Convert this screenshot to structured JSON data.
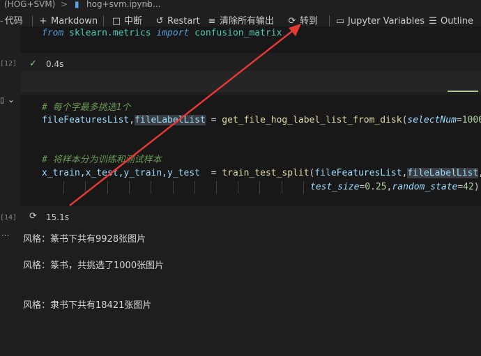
{
  "breadcrumb": {
    "kernel": "(HOG+SVM)",
    "separator": ">",
    "file": "hog+svm.ipynb",
    "more": "..."
  },
  "toolbar": {
    "code": "代码",
    "markdown": "Markdown",
    "interrupt": "中断",
    "restart": "Restart",
    "clear_outputs": "清除所有输出",
    "goto": "转到",
    "variables": "Jupyter Variables",
    "outline": "Outline"
  },
  "cell1": {
    "code": {
      "kw_from": "from",
      "module": "sklearn.metrics",
      "kw_import": "import",
      "name": "confusion_matrix"
    },
    "exec_count": "[12]",
    "status_time": "0.4s"
  },
  "cell2": {
    "comment1": "# 每个字最多挑选1个",
    "line1": {
      "v1": "fileFeaturesList",
      "comma": ",",
      "v2": "fileLabelList",
      "eq": " = ",
      "fn": "get_file_hog_label_list_from_disk",
      "open": "(",
      "param": "selectNum",
      "eq2": "=",
      "num": "1000",
      "close": ")"
    },
    "comment2": "# 将样本分为训练和测试样本",
    "line2": {
      "vars": "x_train,x_test,y_train,y_test",
      "eq": "  = ",
      "fn": "train_test_split",
      "open": "(",
      "a1": "fileFeaturesList",
      "comma": ",",
      "a2": "fileLabelList",
      "comma2": ","
    },
    "line3": {
      "p1": "test_size",
      "eq": "=",
      "n1": "0.25",
      "comma": ",",
      "p2": "random_state",
      "eq2": "=",
      "n2": "42",
      "close": ")"
    },
    "exec_count": "[14]",
    "status_time": "15.1s",
    "outputs": [
      "风格：篆书下共有9928张图片",
      "风格：篆书，共挑选了1000张图片",
      "风格：隶书下共有18421张图片"
    ]
  },
  "colors": {
    "annotation_arrow": "#e53935"
  }
}
